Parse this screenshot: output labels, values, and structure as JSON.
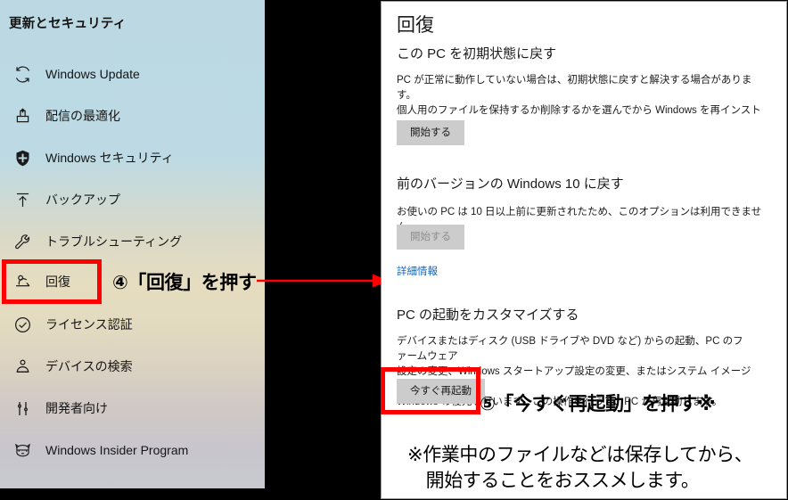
{
  "sidebar": {
    "title": "更新とセキュリティ",
    "items": [
      {
        "label": "Windows Update",
        "icon": "sync-icon",
        "selected": false
      },
      {
        "label": "配信の最適化",
        "icon": "delivery-box-icon",
        "selected": false
      },
      {
        "label": "Windows セキュリティ",
        "icon": "shield-icon",
        "selected": false
      },
      {
        "label": "バックアップ",
        "icon": "backup-up-arrow-icon",
        "selected": false
      },
      {
        "label": "トラブルシューティング",
        "icon": "wrench-icon",
        "selected": false
      },
      {
        "label": "回復",
        "icon": "recovery-icon",
        "selected": true
      },
      {
        "label": "ライセンス認証",
        "icon": "check-circle-icon",
        "selected": false
      },
      {
        "label": "デバイスの検索",
        "icon": "find-device-icon",
        "selected": false
      },
      {
        "label": "開発者向け",
        "icon": "developer-tools-icon",
        "selected": false
      },
      {
        "label": "Windows Insider Program",
        "icon": "ninja-cat-icon",
        "selected": false
      }
    ]
  },
  "recovery_page": {
    "title": "回復",
    "sections": [
      {
        "heading": "この PC を初期状態に戻す",
        "body": "PC が正常に動作していない場合は、初期状態に戻すと解決する場合があります。\n個人用のファイルを保持するか削除するかを選んでから Windows を再インストール\nできます。",
        "button": "開始する",
        "button_disabled": false
      },
      {
        "heading": "前のバージョンの Windows 10 に戻す",
        "body": "お使いの PC は 10 日以上前に更新されたため、このオプションは利用できません。",
        "button": "開始する",
        "button_disabled": true,
        "link": "詳細情報"
      },
      {
        "heading": "PC の起動をカスタマイズする",
        "body": "デバイスまたはディスク (USB ドライブや DVD など) からの起動、PC のファームウェア\n設定の変更、Windows スタートアップ設定の変更、またはシステム イメージからの\nWindows の復元を行います。この操作を行うと、PC が再起動します。",
        "button": "今すぐ再起動",
        "button_disabled": false
      }
    ]
  },
  "annotations": {
    "step4": "④「回復」を押す",
    "step5": "⑤「今すぐ再起動」を押す※",
    "footer_note": "※作業中のファイルなどは保存してから、\n　開始することをおススメします。",
    "arrow_label": "step4-arrow"
  },
  "colors": {
    "highlight_red": "#ff0000",
    "link_blue": "#1464b4",
    "button_gray": "#cccccc",
    "sidebar_top": "#bcd9e3",
    "sidebar_mid": "#e3dbc0",
    "sidebar_bottom": "#c9c9d0"
  }
}
